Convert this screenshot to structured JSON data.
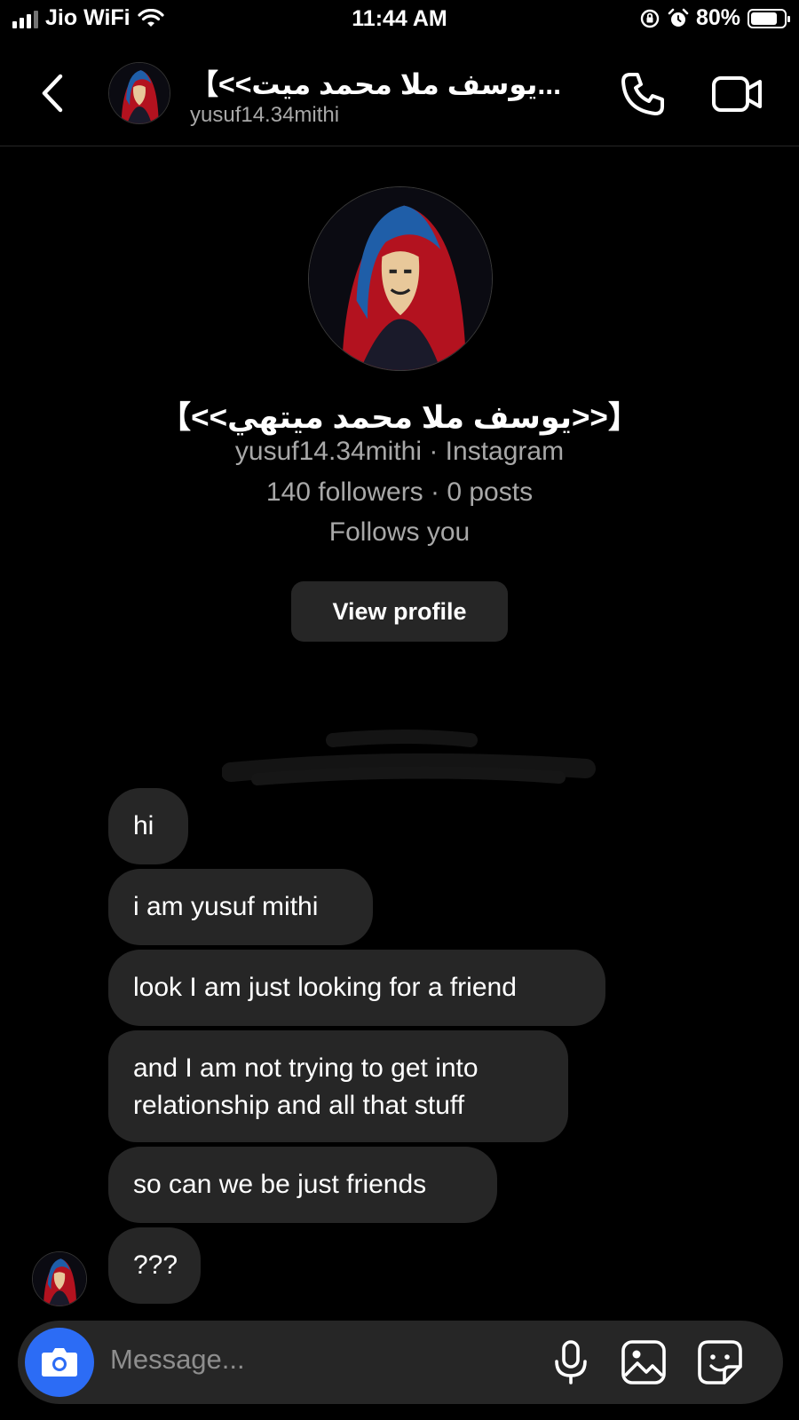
{
  "status": {
    "carrier": "Jio WiFi",
    "time": "11:44 AM",
    "battery": "80%",
    "battery_level": 0.8
  },
  "header": {
    "name": "【<<يوسف ملا محمد ميت...",
    "username": "yusuf14.34mithi"
  },
  "profile": {
    "name": "【<<يوسف ملا محمد ميتهي>>】",
    "subtitle": "yusuf14.34mithi · Instagram",
    "stats": "140 followers · 0 posts",
    "relationship": "Follows you",
    "view_profile_label": "View profile"
  },
  "messages": [
    {
      "text": "hi"
    },
    {
      "text": "i am yusuf mithi"
    },
    {
      "text": "look I am just looking for a friend"
    },
    {
      "text": "and I am not trying to get into relationship and all that stuff"
    },
    {
      "text": "so can we be just friends"
    },
    {
      "text": "???"
    }
  ],
  "composer": {
    "placeholder": "Message..."
  },
  "icons": {
    "back": "chevron-left-icon",
    "call": "phone-icon",
    "video": "video-camera-icon",
    "camera": "camera-icon",
    "mic": "microphone-icon",
    "gallery": "image-icon",
    "sticker": "sticker-icon"
  },
  "colors": {
    "background": "#000000",
    "bubble": "#262626",
    "accent": "#2c6cf5",
    "muted": "#a8a8a8"
  }
}
